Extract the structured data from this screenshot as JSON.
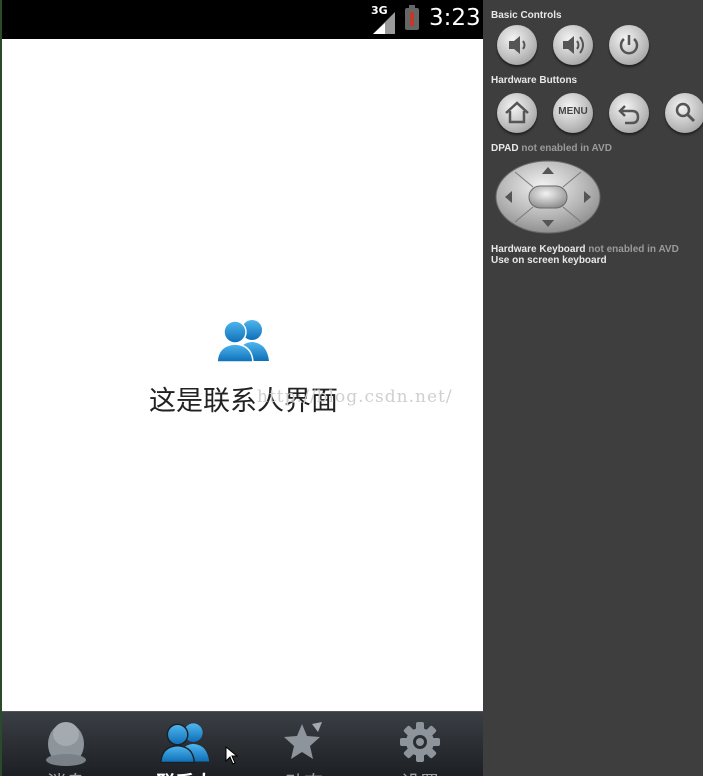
{
  "status_bar": {
    "network": "3G",
    "time": "3:23"
  },
  "page": {
    "message": "这是联系人界面",
    "watermark": "http://blog.csdn.net/"
  },
  "tabs": [
    {
      "label": "消息",
      "icon": "qq-penguin-icon",
      "active": false
    },
    {
      "label": "联系人",
      "icon": "contacts-icon",
      "active": true
    },
    {
      "label": "动态",
      "icon": "star-icon",
      "active": false
    },
    {
      "label": "设置",
      "icon": "gear-icon",
      "active": false
    }
  ],
  "emulator_panel": {
    "basic_controls_title": "Basic Controls",
    "hardware_buttons_title": "Hardware Buttons",
    "dpad_title": "DPAD",
    "dpad_status": "not enabled in AVD",
    "keyboard_title": "Hardware Keyboard",
    "keyboard_status": "not enabled in AVD",
    "keyboard_note": "Use on screen keyboard",
    "menu_label": "MENU",
    "basic_controls": [
      "volume-down-icon",
      "volume-up-icon",
      "power-icon"
    ],
    "hardware_buttons": [
      "home-icon",
      "menu-button",
      "back-icon",
      "search-icon"
    ]
  },
  "colors": {
    "accent_blue": "#1b8fd6",
    "tab_bar": "#2a2e33",
    "panel_bg": "#3e3e3e"
  }
}
